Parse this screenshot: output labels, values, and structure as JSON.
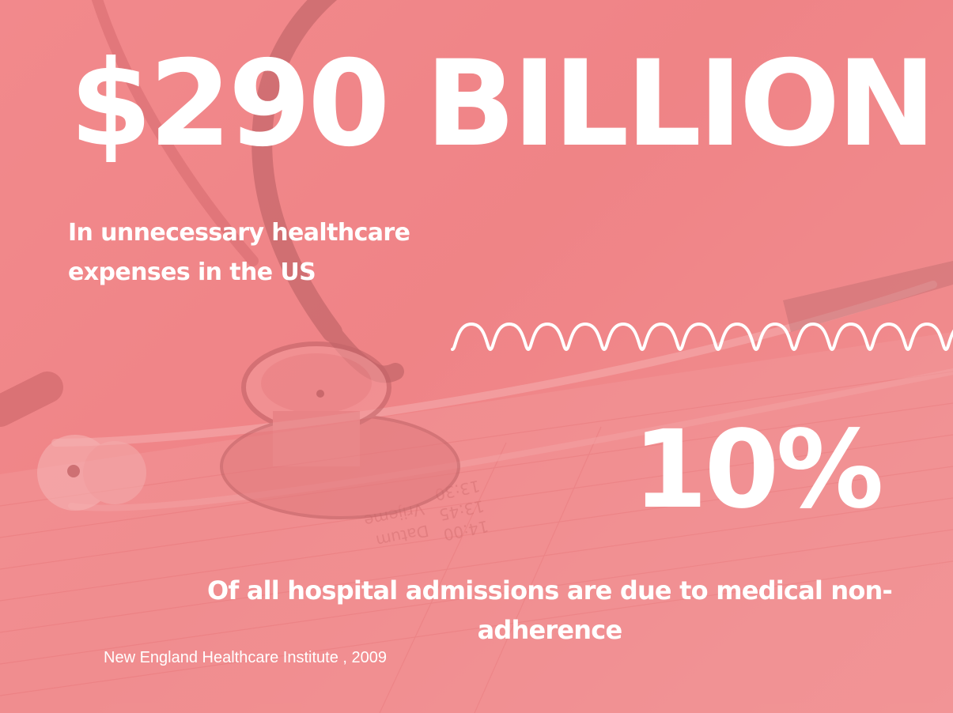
{
  "headline": "$290 BILLION",
  "headline_subtitle": "In unnecessary healthcare expenses in the US",
  "statistic": "10%",
  "statistic_subtitle": "Of all hospital admissions are due to medical non-adherence",
  "source": "New England Healthcare Institute , 2009",
  "background_image_text": [
    "14:00",
    "13:45",
    "13:30",
    "Datum",
    "Vrijeme"
  ],
  "colors": {
    "overlay": "#f0898c",
    "text": "#ffffff"
  },
  "icons": [
    "stethoscope-image",
    "wave-divider"
  ]
}
